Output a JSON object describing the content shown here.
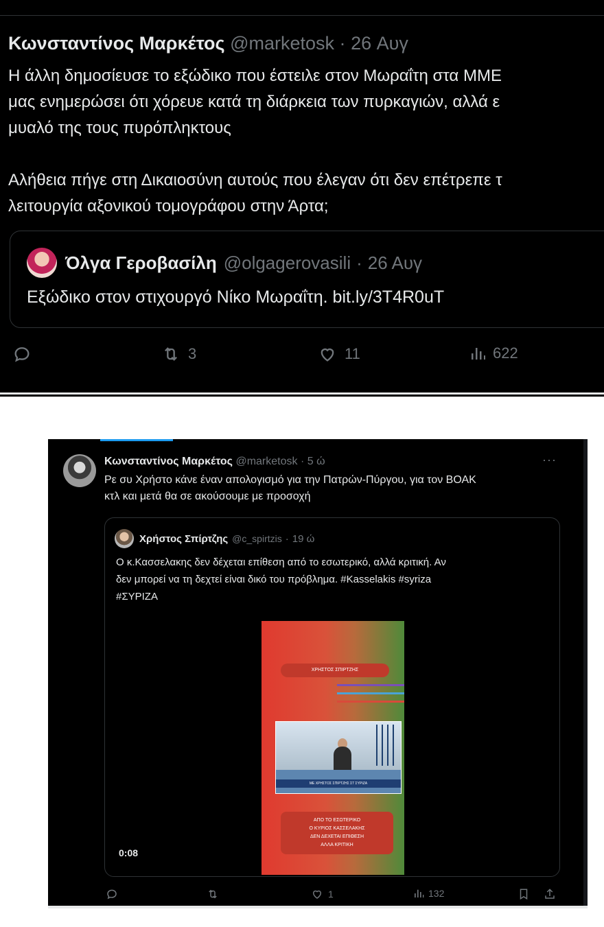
{
  "tweet1": {
    "author_name": "Κωνσταντίνος Μαρκέτος",
    "handle": "@marketosk",
    "separator": "·",
    "date": "26 Αυγ",
    "body_lines": [
      "Η άλλη δημοσίευσε το εξώδικο που έστειλε στον Μωραΐτη στα ΜΜΕ",
      "μας ενημερώσει ότι χόρευε κατά τη διάρκεια των πυρκαγιών, αλλά ε",
      "μυαλό της τους πυρόπληκτους",
      "Αλήθεια πήγε στη Δικαιοσύνη αυτούς που έλεγαν ότι δεν επέτρεπε τ",
      "λειτουργία αξονικού τομογράφου στην Άρτα;"
    ],
    "quote": {
      "author_name": "Όλγα Γεροβασίλη",
      "handle": "@olgagerovasili",
      "separator": "·",
      "date": "26 Αυγ",
      "text": "Εξώδικο στον στιχουργό Νίκο Μωραΐτη. bit.ly/3T4R0uT"
    },
    "actions": {
      "retweets": "3",
      "likes": "11",
      "views": "622"
    }
  },
  "tweet2": {
    "author_name": "Κωνσταντίνος Μαρκέτος",
    "handle": "@marketosk",
    "separator": "·",
    "time": "5 ώ",
    "more": "···",
    "body_lines": [
      "Ρε συ Χρήστο κάνε έναν απολογισμό για την Πατρών-Πύργου, για τον ΒΟΑΚ",
      "κτλ και μετά θα σε ακούσουμε με προσοχή"
    ],
    "quote": {
      "author_name": "Χρήστος Σπίρτζης",
      "handle": "@c_spirtzis",
      "separator": "·",
      "time": "19 ώ",
      "body_lines": [
        "Ο κ.Κασσελακης δεν δέχεται επίθεση από το εσωτερικό, αλλά κριτική. Αν",
        "δεν μπορεί να τη δεχτεί είναι δικό του πρόβλημα. #Kasselakis #syriza",
        "#ΣΥΡΙΖΑ"
      ],
      "video": {
        "caption_top": "ΧΡΗΣΤΟΣ ΣΠΙΡΤΖΗΣ",
        "ticker": "ΜΕ ΧΡΗΣΤΟΣ ΣΠΙΡΤΖΗΣ ΣΤ ΣΥΡΙΖΑ",
        "caption_bottom": [
          "ΑΠΟ ΤΟ ΕΣΩΤΕΡΙΚΟ",
          "Ο ΚΥΡΙΟΣ ΚΑΣΣΕΛΑΚΗΣ",
          "ΔΕΝ ΔΕΧΕΤΑΙ ΕΠΙΘΕΣΗ",
          "ΑΛΛΑ ΚΡΙΤΙΚΗ"
        ],
        "duration": "0:08"
      }
    },
    "actions": {
      "likes": "1",
      "views": "132"
    }
  },
  "colors": {
    "background": "#000000",
    "text": "#e7e9ea",
    "muted": "#71767b",
    "border": "#2f3336",
    "accent": "#1d9bf0"
  },
  "icons": [
    "reply-icon",
    "retweet-icon",
    "like-icon",
    "views-icon",
    "bookmark-icon",
    "share-icon",
    "more-icon"
  ]
}
